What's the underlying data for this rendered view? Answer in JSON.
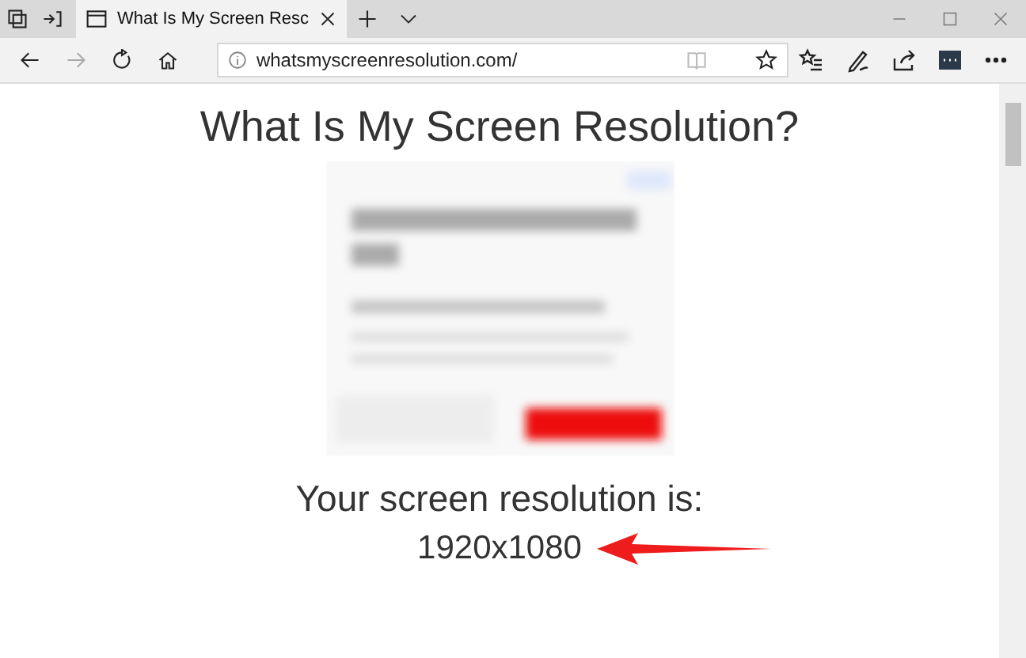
{
  "tab": {
    "title": "What Is My Screen Resc",
    "selected": true
  },
  "address_bar": {
    "url": "whatsmyscreenresolution.com/"
  },
  "page": {
    "heading": "What Is My Screen Resolution?",
    "label": "Your screen resolution is:",
    "resolution": "1920x1080"
  }
}
